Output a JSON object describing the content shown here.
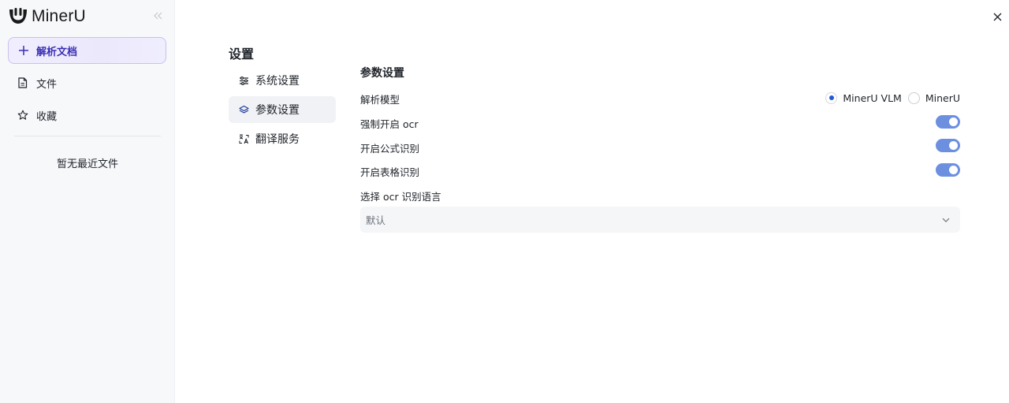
{
  "app": {
    "brand_name": "MinerU"
  },
  "sidebar": {
    "new_doc_label": "解析文档",
    "items": [
      {
        "label": "文件",
        "icon": "file-icon"
      },
      {
        "label": "收藏",
        "icon": "star-icon"
      }
    ],
    "empty_recent": "暂无最近文件"
  },
  "settings": {
    "title": "设置",
    "menu": [
      {
        "label": "系统设置",
        "icon": "sliders-icon",
        "active": false
      },
      {
        "label": "参数设置",
        "icon": "layers-icon",
        "active": true
      },
      {
        "label": "翻译服务",
        "icon": "translate-icon",
        "active": false
      }
    ],
    "section_title": "参数设置",
    "model": {
      "label": "解析模型",
      "options": [
        "MinerU VLM",
        "MinerU"
      ],
      "selected": "MinerU VLM"
    },
    "force_ocr": {
      "label": "强制开启 ocr",
      "enabled": true
    },
    "formula": {
      "label": "开启公式识别",
      "enabled": true
    },
    "table": {
      "label": "开启表格识别",
      "enabled": true
    },
    "ocr_language": {
      "label": "选择 ocr 识别语言",
      "value": "默认"
    }
  },
  "colors": {
    "accent": "#1f58d8",
    "toggle_on": "#6c8fe0",
    "new_doc_text": "#3b2fb5",
    "sidebar_bg": "#f7f8fa"
  }
}
